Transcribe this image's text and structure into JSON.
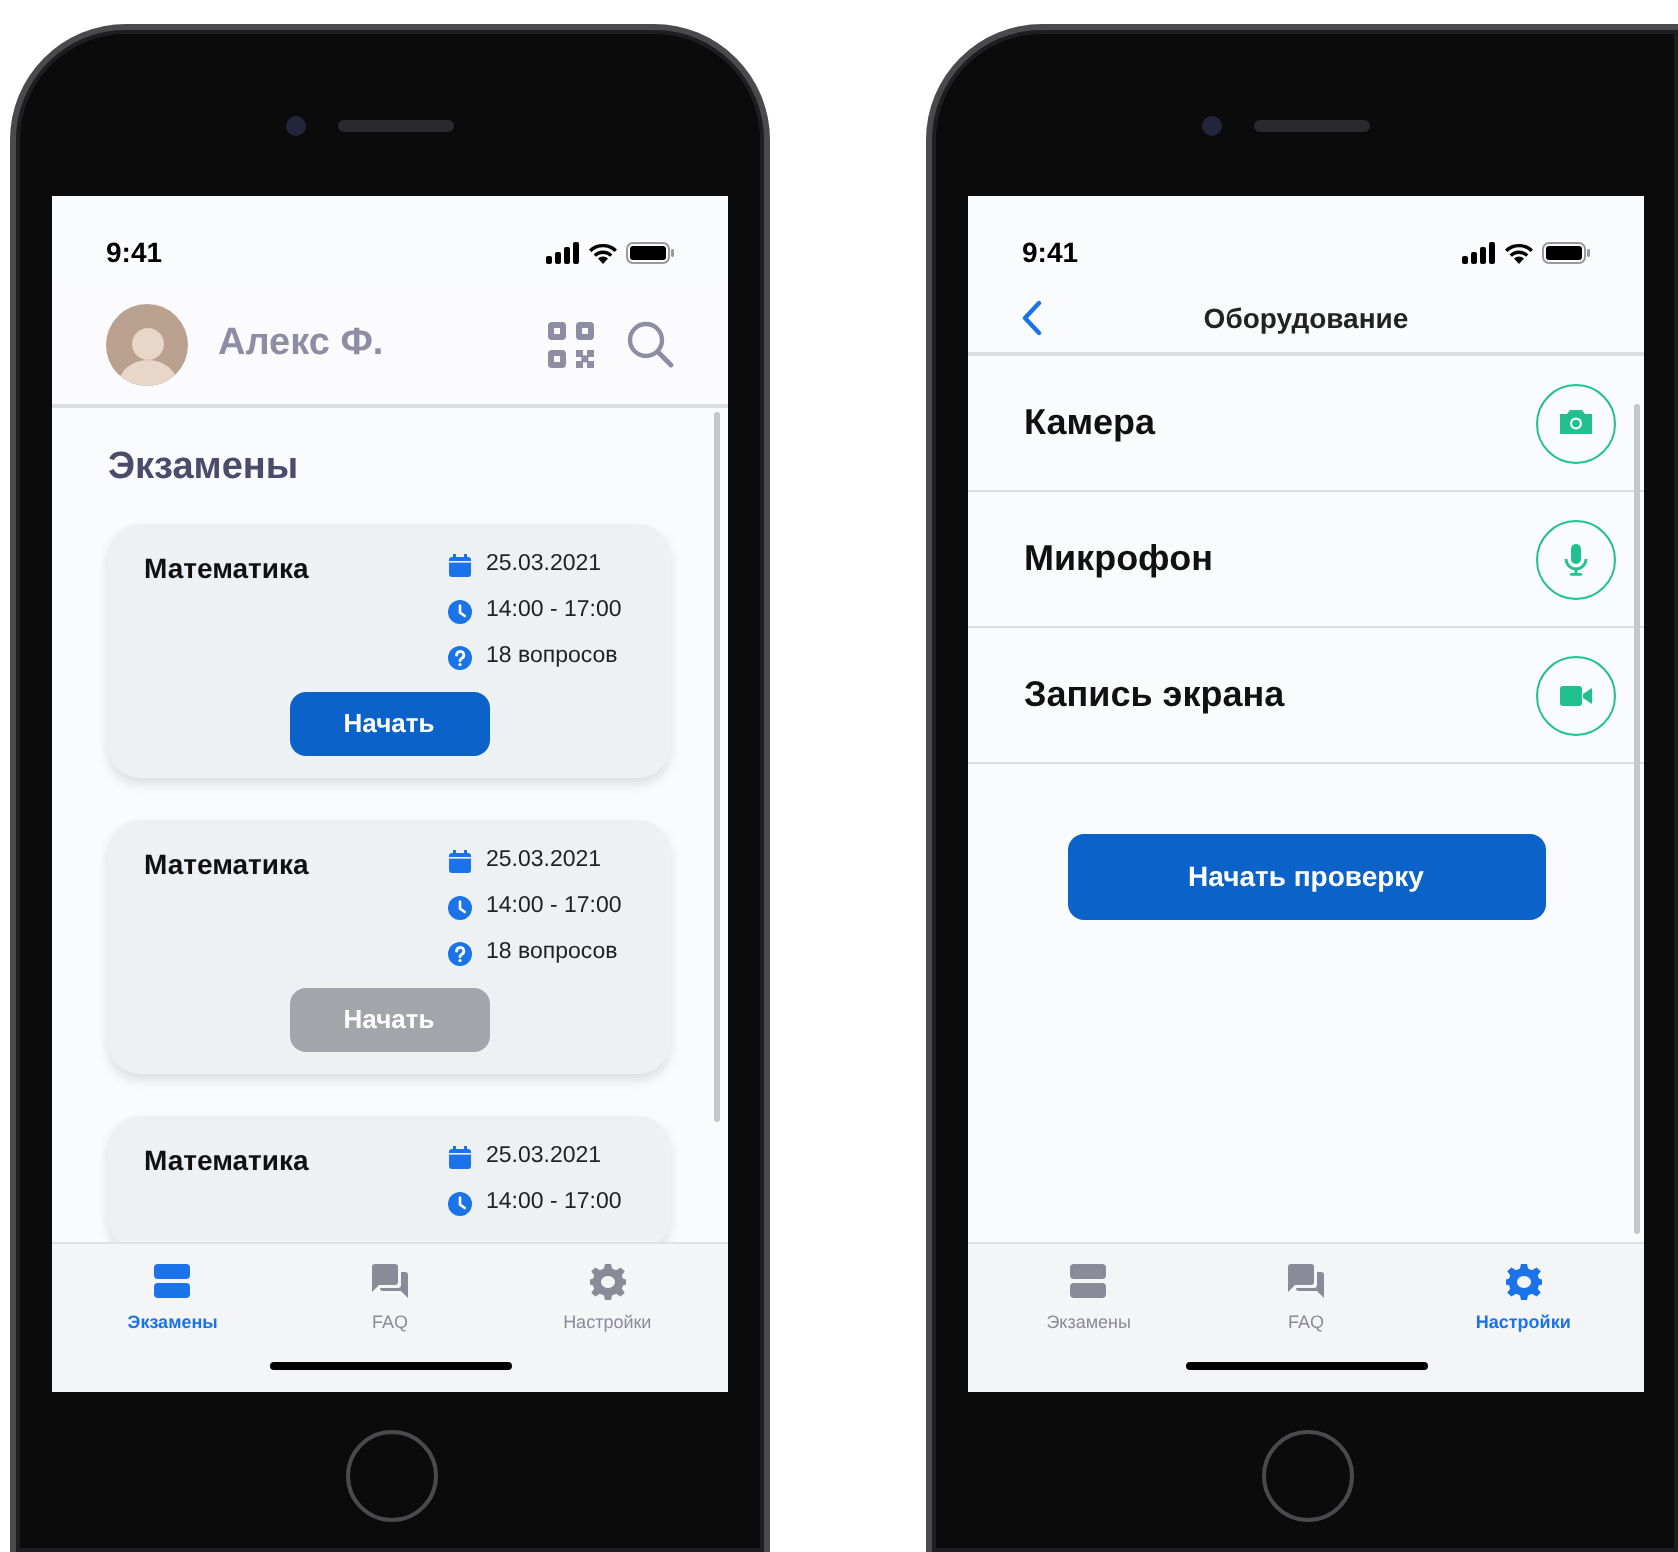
{
  "phones": [
    {
      "kind": "exams",
      "status_time": "9:41",
      "user_name": "Алекс Ф.",
      "section_title": "Экзамены",
      "exams": [
        {
          "subject": "Математика",
          "date": "25.03.2021",
          "time": "14:00 - 17:00",
          "questions": "18 вопросов",
          "button": {
            "label": "Начать",
            "disabled": false
          }
        },
        {
          "subject": "Математика",
          "date": "25.03.2021",
          "time": "14:00 - 17:00",
          "questions": "18 вопросов",
          "button": {
            "label": "Начать",
            "disabled": true
          }
        },
        {
          "subject": "Математика",
          "date": "25.03.2021",
          "time": "14:00 - 17:00"
        }
      ],
      "tab_bar": [
        {
          "kind": "exams",
          "label": "Экзамены",
          "selected": true
        },
        {
          "kind": "faq",
          "label": "FAQ",
          "selected": false
        },
        {
          "kind": "settings",
          "label": "Настройки",
          "selected": false
        }
      ]
    },
    {
      "kind": "equipment",
      "status_time": "9:41",
      "nav_title": "Оборудование",
      "devices": [
        {
          "kind": "camera",
          "name": "Камера"
        },
        {
          "kind": "microphone",
          "name": "Микрофон"
        },
        {
          "kind": "screen",
          "name": "Запись экрана"
        }
      ],
      "button": "Начать проверку",
      "tab_bar": [
        {
          "kind": "exams",
          "label": "Экзамены",
          "selected": false
        },
        {
          "kind": "faq",
          "label": "FAQ",
          "selected": false
        },
        {
          "kind": "settings",
          "label": "Настройки",
          "selected": true
        }
      ]
    }
  ]
}
